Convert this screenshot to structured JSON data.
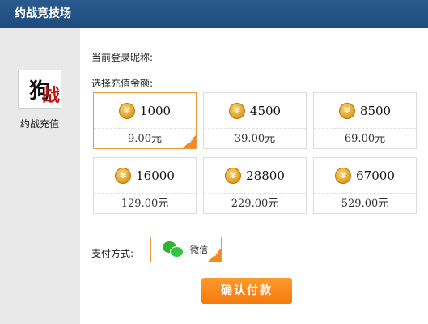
{
  "window": {
    "title": "约战竞技场"
  },
  "sidebar": {
    "items": [
      {
        "label": "约战充值",
        "icon": "game-logo-icon"
      }
    ]
  },
  "main": {
    "nickname_label": "当前登录昵称:",
    "amount_label": "选择充值金额:",
    "packages": [
      {
        "coins": "1000",
        "price": "9.00元",
        "selected": true
      },
      {
        "coins": "4500",
        "price": "39.00元",
        "selected": false
      },
      {
        "coins": "8500",
        "price": "69.00元",
        "selected": false
      },
      {
        "coins": "16000",
        "price": "129.00元",
        "selected": false
      },
      {
        "coins": "28800",
        "price": "229.00元",
        "selected": false
      },
      {
        "coins": "67000",
        "price": "529.00元",
        "selected": false
      }
    ],
    "payment_label": "支付方式:",
    "payment_options": [
      {
        "label": "微信",
        "icon": "wechat-icon",
        "selected": true
      }
    ],
    "confirm_label": "确认付款"
  },
  "colors": {
    "titlebar": "#215183",
    "accent": "#f08a24",
    "sidebar": "#e9e9e9"
  }
}
